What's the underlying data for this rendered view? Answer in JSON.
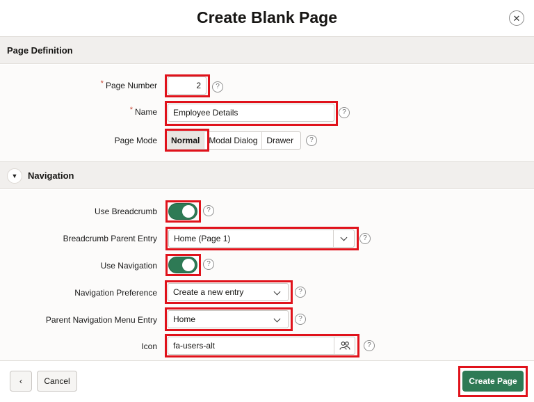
{
  "dialog": {
    "title": "Create Blank Page",
    "close_icon": "close-icon"
  },
  "page_definition": {
    "title": "Page Definition",
    "page_number_label": "Page Number",
    "page_number_value": "2",
    "name_label": "Name",
    "name_value": "Employee Details",
    "page_mode_label": "Page Mode",
    "page_mode_options": [
      "Normal",
      "Modal Dialog",
      "Drawer"
    ],
    "page_mode_selected": "Normal",
    "required_marker": "*"
  },
  "navigation": {
    "title": "Navigation",
    "use_breadcrumb_label": "Use Breadcrumb",
    "use_breadcrumb_on": true,
    "breadcrumb_parent_label": "Breadcrumb Parent Entry",
    "breadcrumb_parent_value": "Home (Page 1)",
    "use_navigation_label": "Use Navigation",
    "use_navigation_on": true,
    "nav_pref_label": "Navigation Preference",
    "nav_pref_value": "Create a new entry",
    "parent_nav_label": "Parent Navigation Menu Entry",
    "parent_nav_value": "Home",
    "icon_label": "Icon",
    "icon_value": "fa-users-alt",
    "icon_picker": "users-icon"
  },
  "footer": {
    "back_icon": "chevron-left-icon",
    "cancel_label": "Cancel",
    "create_label": "Create Page"
  },
  "help_glyph": "?",
  "colors": {
    "accent": "#2e7a55",
    "highlight": "#e0121b",
    "section_bg": "#f1efed"
  }
}
